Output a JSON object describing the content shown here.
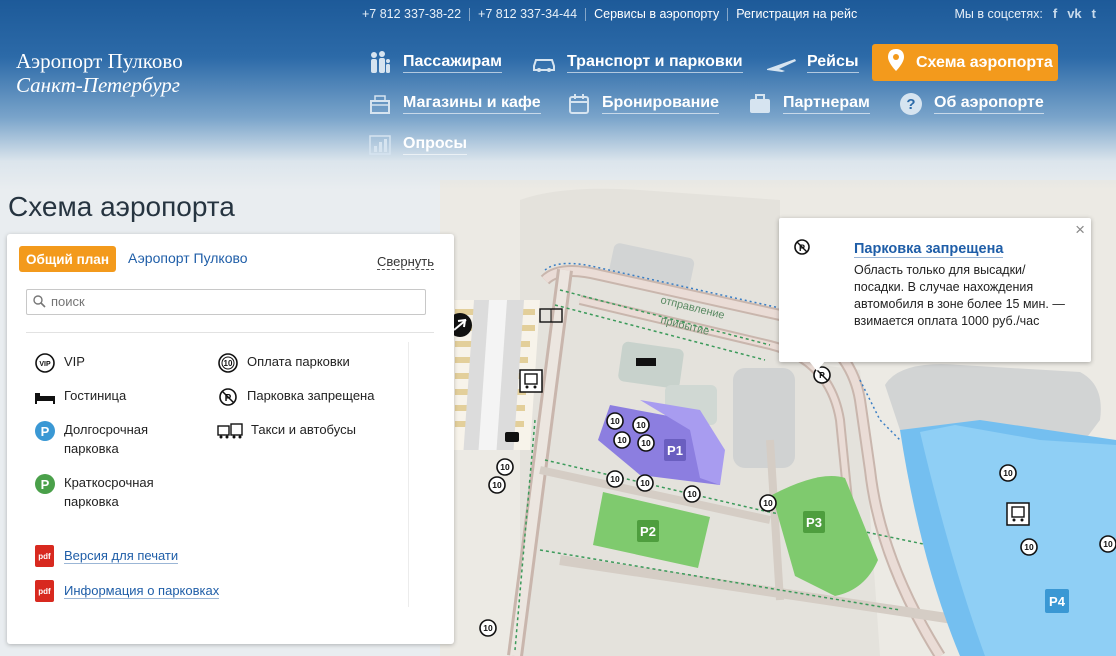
{
  "topbar": {
    "phone1": "+7 812 337-38-22",
    "phone2": "+7 812 337-34-44",
    "services": "Сервисы в аэропорту",
    "checkin": "Регистрация на рейс",
    "social_label": "Мы в соцсетях:",
    "social_icons": [
      "facebook-icon",
      "vk-icon",
      "twitter-icon"
    ]
  },
  "logo": {
    "line1": "Аэропорт Пулково",
    "line2": "Санкт-Петербург"
  },
  "nav": {
    "passengers": "Пассажирам",
    "transport": "Транспорт и парковки",
    "flights": "Рейсы",
    "scheme": "Схема аэропорта",
    "shops": "Магазины и кафе",
    "booking": "Бронирование",
    "partners": "Партнерам",
    "about": "Об аэропорте",
    "polls": "Опросы"
  },
  "page": {
    "title": "Схема аэропорта"
  },
  "panel": {
    "tab_active": "Общий план",
    "tab_other": "Аэропорт Пулково",
    "collapse": "Свернуть",
    "search_placeholder": "поиск",
    "legend_left": {
      "vip": "VIP",
      "hotel": "Гостиница",
      "long_parking_1": "Долгосрочная",
      "long_parking_2": "парковка",
      "short_parking_1": "Краткосрочная",
      "short_parking_2": "парковка"
    },
    "legend_right": {
      "paid_parking": "Оплата парковки",
      "no_parking": "Парковка запрещена",
      "taxi_bus": "Такси и автобусы"
    },
    "links": {
      "print": "Версия для печати",
      "parking_info": "Информация о парковках"
    },
    "colors": {
      "long": "#3a98d4",
      "short": "#4aa04a",
      "accent": "#f39a1c"
    }
  },
  "popup": {
    "title": "Парковка запрещена",
    "text": "Область только для высадки/ посадки. В случае нахождения автомобиля в зоне более 15 мин. — взимается оплата 1000 руб./час"
  },
  "map": {
    "departure_label": "отправление",
    "arrival_label": "прибытие",
    "parking_labels": [
      "P1",
      "P2",
      "P3",
      "P4"
    ],
    "paid_icon_text": "10"
  }
}
